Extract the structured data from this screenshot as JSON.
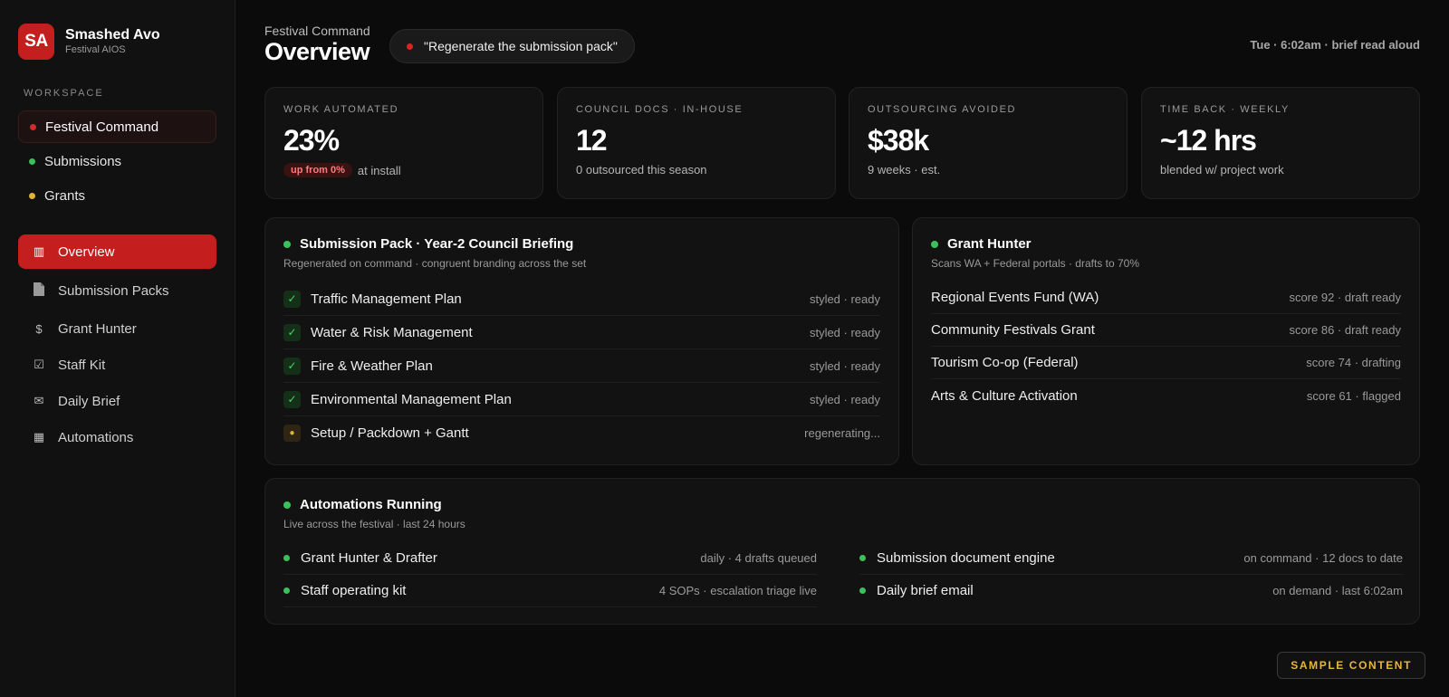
{
  "brand": {
    "mark": "SA",
    "name": "Smashed Avo",
    "sub": "Festival AIOS"
  },
  "workspace": {
    "label": "WORKSPACE",
    "items": [
      {
        "label": "Festival Command",
        "dot_color": "#d42a2a"
      },
      {
        "label": "Submissions",
        "dot_color": "#3cc15a"
      },
      {
        "label": "Grants",
        "dot_color": "#e0b43a"
      }
    ]
  },
  "nav": {
    "items": [
      {
        "label": "Overview",
        "icon": "grid-icon"
      },
      {
        "label": "Submission Packs",
        "icon": "document-icon"
      },
      {
        "label": "Grant Hunter",
        "icon": "dollar-icon"
      },
      {
        "label": "Staff Kit",
        "icon": "checkbox-icon"
      },
      {
        "label": "Daily Brief",
        "icon": "mail-icon"
      },
      {
        "label": "Automations",
        "icon": "table-icon"
      }
    ]
  },
  "header": {
    "eyebrow": "Festival Command",
    "title": "Overview",
    "command": "\"Regenerate the submission pack\"",
    "status": "Tue · 6:02am · brief read aloud"
  },
  "kpis": [
    {
      "label": "WORK AUTOMATED",
      "value": "23%",
      "badge": "up from 0%",
      "sub": "at install"
    },
    {
      "label": "COUNCIL DOCS · IN-HOUSE",
      "value": "12",
      "sub": "0 outsourced this season"
    },
    {
      "label": "OUTSOURCING AVOIDED",
      "value": "$38k",
      "sub": "9 weeks · est."
    },
    {
      "label": "TIME BACK · WEEKLY",
      "value": "~12 hrs",
      "sub": "blended w/ project work"
    }
  ],
  "submission_pack": {
    "title": "Submission Pack · Year-2 Council Briefing",
    "sub": "Regenerated on command · congruent branding across the set",
    "rows": [
      {
        "label": "Traffic Management Plan",
        "status": "styled · ready",
        "mark": "✓"
      },
      {
        "label": "Water & Risk Management",
        "status": "styled · ready",
        "mark": "✓"
      },
      {
        "label": "Fire & Weather Plan",
        "status": "styled · ready",
        "mark": "✓"
      },
      {
        "label": "Environmental Management Plan",
        "status": "styled · ready",
        "mark": "✓"
      },
      {
        "label": "Setup / Packdown + Gantt",
        "status": "regenerating...",
        "mark": "●"
      }
    ]
  },
  "grant_hunter": {
    "title": "Grant Hunter",
    "sub": "Scans WA + Federal portals · drafts to 70%",
    "rows": [
      {
        "label": "Regional Events Fund (WA)",
        "status": "score 92 · draft ready"
      },
      {
        "label": "Community Festivals Grant",
        "status": "score 86 · draft ready"
      },
      {
        "label": "Tourism Co-op (Federal)",
        "status": "score 74 · drafting"
      },
      {
        "label": "Arts & Culture Activation",
        "status": "score 61 · flagged"
      }
    ]
  },
  "automations": {
    "title": "Automations Running",
    "sub": "Live across the festival · last 24 hours",
    "rows": [
      {
        "label": "Grant Hunter & Drafter",
        "status": "daily · 4 drafts queued"
      },
      {
        "label": "Submission document engine",
        "status": "on command · 12 docs to date"
      },
      {
        "label": "Staff operating kit",
        "status": "4 SOPs · escalation triage live"
      },
      {
        "label": "Daily brief email",
        "status": "on demand · last 6:02am"
      }
    ]
  },
  "sample_badge": "SAMPLE CONTENT",
  "colors": {
    "accent": "#c41e1e",
    "ok": "#3cc15a",
    "warn": "#e0b43a",
    "bg": "#0b0b0b"
  }
}
